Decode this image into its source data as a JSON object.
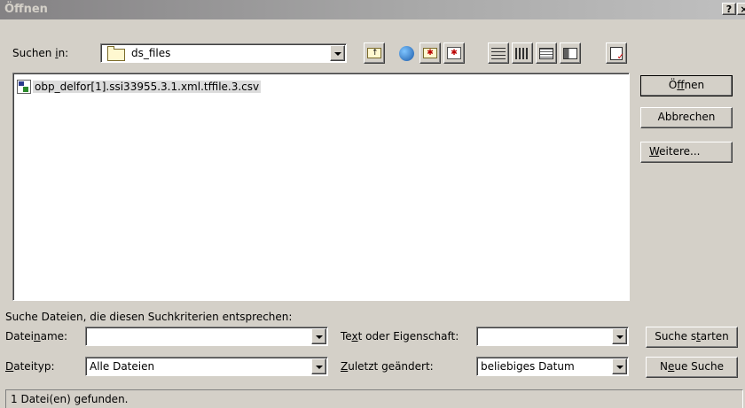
{
  "window": {
    "title": "Öffnen",
    "help_label": "?",
    "close_label": "×"
  },
  "look_in": {
    "label_pre": "Suchen ",
    "label_key": "i",
    "label_post": "n:",
    "value": "ds_files"
  },
  "toolbar": {
    "icons": [
      "up-folder-icon",
      "search-web-icon",
      "new-folder-icon",
      "add-to-favorites-icon",
      "list-view-icon",
      "details-view-icon",
      "properties-view-icon",
      "preview-view-icon",
      "commands-icon"
    ]
  },
  "file_list": {
    "files": [
      {
        "name": "obp_delfor[1].ssi33955.3.1.xml.tffile.3.csv",
        "icon": "csv-file-icon"
      }
    ]
  },
  "buttons": {
    "open": {
      "pre": "Ö",
      "key": "f",
      "post": "fnen"
    },
    "cancel": "Abbrechen",
    "more": {
      "pre": "",
      "key": "W",
      "post": "eitere..."
    },
    "start_search": {
      "pre": "Suche s",
      "key": "t",
      "post": "arten"
    },
    "new_search": {
      "pre": "N",
      "key": "e",
      "post": "ue Suche"
    }
  },
  "search": {
    "heading": "Suche Dateien, die diesen Suchkriterien entsprechen:",
    "filename": {
      "pre": "Datei",
      "key": "n",
      "post": "ame:",
      "value": ""
    },
    "filetype": {
      "pre": "",
      "key": "D",
      "post": "ateityp:",
      "value": "Alle Dateien"
    },
    "text_prop": {
      "pre": "Te",
      "key": "x",
      "post": "t oder Eigenschaft:",
      "value": ""
    },
    "modified": {
      "pre": "",
      "key": "Z",
      "post": "uletzt geändert:",
      "value": "beliebiges Datum"
    }
  },
  "status": {
    "text": "1 Datei(en) gefunden."
  }
}
